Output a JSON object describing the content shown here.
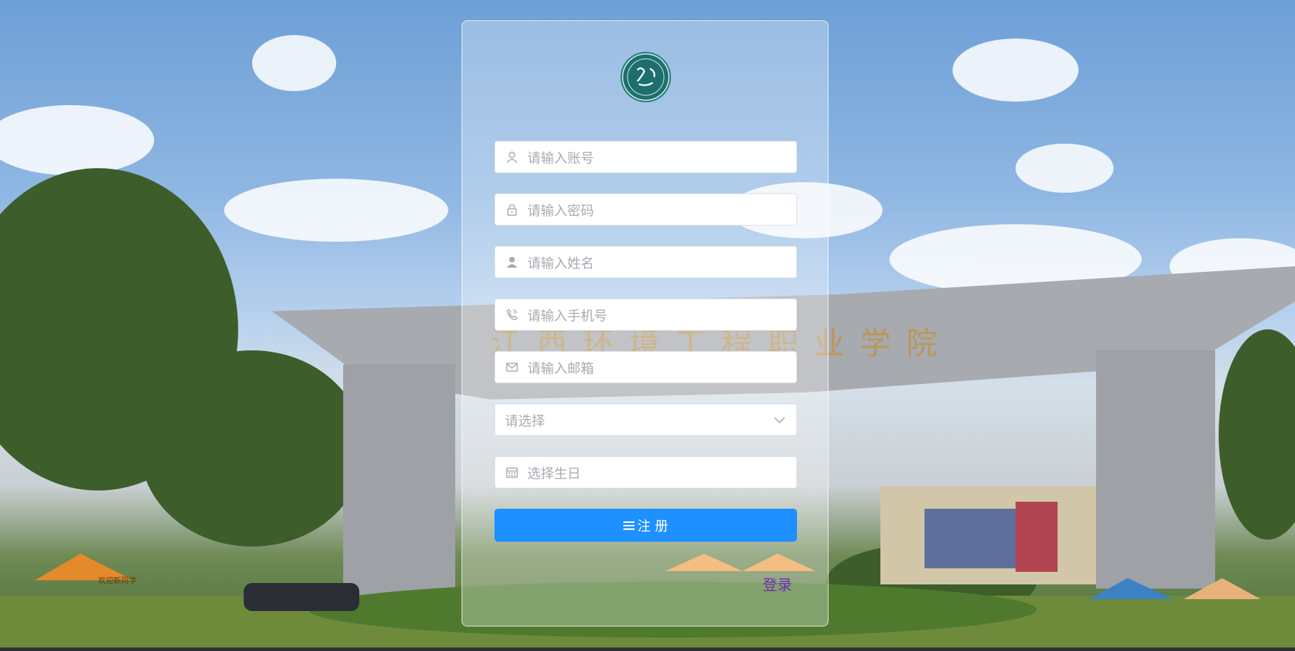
{
  "form": {
    "account_placeholder": "请输入账号",
    "password_placeholder": "请输入密码",
    "name_placeholder": "请输入姓名",
    "phone_placeholder": "请输入手机号",
    "email_placeholder": "请输入邮箱",
    "select_placeholder": "请选择",
    "birthday_placeholder": "选择生日",
    "register_label": "注 册",
    "login_link": "登录"
  },
  "background": {
    "gate_sign": "江西环境工程职业学院",
    "tent_sign": "欢迎新同学"
  },
  "icons": {
    "account": "user-icon",
    "password": "lock-icon",
    "name": "person-icon",
    "phone": "phone-icon",
    "email": "mail-icon",
    "select": "chevron-down-icon",
    "birthday": "calendar-icon",
    "register": "menu-icon"
  },
  "colors": {
    "primary": "#1e90ff",
    "link": "#6a2fb5",
    "placeholder": "#a8abb2"
  }
}
